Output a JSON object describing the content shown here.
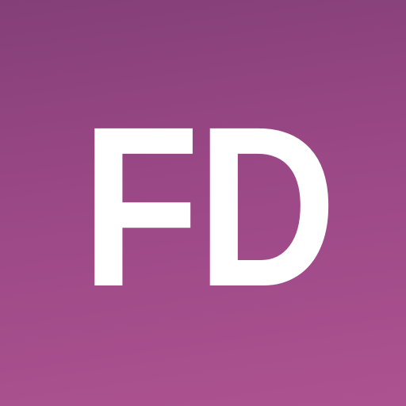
{
  "icon": {
    "monogram": "FD",
    "colors": {
      "background_top": "#843f78",
      "background_bottom": "#ad5291",
      "text": "#ffffff"
    }
  }
}
